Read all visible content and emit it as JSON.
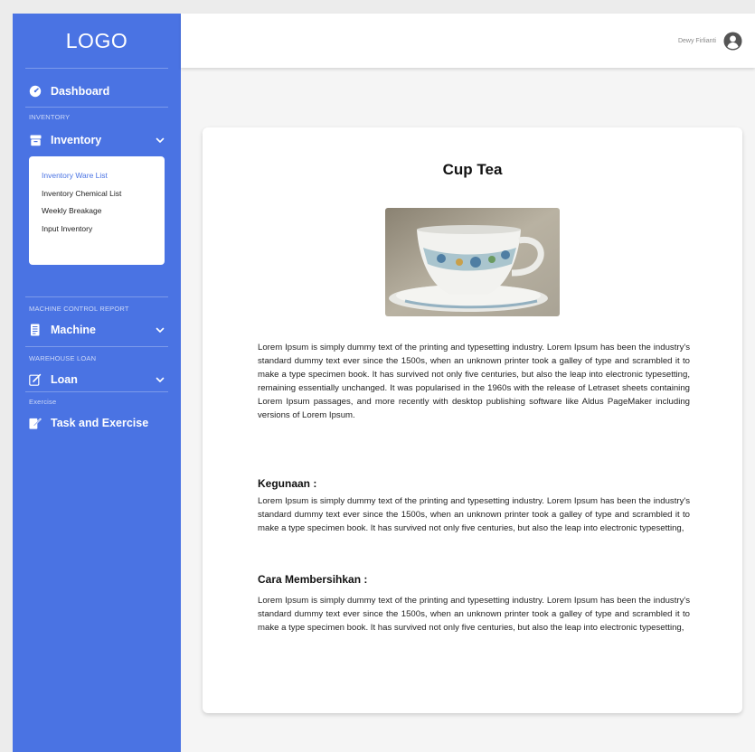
{
  "sidebar": {
    "logo": "LOGO",
    "dashboard": "Dashboard",
    "section_inventory": "INVENTORY",
    "inventory": "Inventory",
    "inventory_sub": [
      "Inventory Ware List",
      "Inventory Chemical List",
      "Weekly Breakage",
      "Input Inventory"
    ],
    "section_machine": "MACHINE CONTROL REPORT",
    "machine": "Machine",
    "section_warehouse": "WAREHOUSE LOAN",
    "loan": "Loan",
    "section_exercise": "Exercise",
    "task": "Task and Exercise"
  },
  "header": {
    "user_name": "Dewy Firlianti"
  },
  "content": {
    "title": "Cup Tea",
    "image_alt": "cup-tea-photo",
    "description": "Lorem Ipsum is simply dummy text of the printing and typesetting industry. Lorem Ipsum has been the industry's standard dummy text ever since the 1500s, when an unknown printer took a galley of type and scrambled it to make a type specimen book. It has survived not only five centuries, but also the leap into electronic typesetting, remaining essentially unchanged. It was popularised in the 1960s with the release of Letraset sheets containing Lorem Ipsum passages, and more recently with desktop publishing software like Aldus PageMaker including versions of Lorem Ipsum.",
    "kegunaan_heading": "Kegunaan :",
    "kegunaan_text": "Lorem Ipsum is simply dummy text of the printing and typesetting industry. Lorem Ipsum has been the industry's standard dummy text ever since the 1500s, when an unknown printer took a galley of type and scrambled it to make a type specimen book. It has survived not only five centuries, but also the leap into electronic typesetting,",
    "cara_heading": "Cara Membersihkan :",
    "cara_text": "Lorem Ipsum is simply dummy text of the printing and typesetting industry. Lorem Ipsum has been the industry's standard dummy text ever since the 1500s, when an unknown printer took a galley of type and scrambled it to make a type specimen book. It has survived not only five centuries, but also the leap into electronic typesetting,"
  },
  "colors": {
    "sidebar_bg": "#4a73e3",
    "active_link": "#4a73e3",
    "page_bg": "#f5f5f5"
  },
  "icons": {
    "dashboard": "speedometer-icon",
    "inventory": "archive-box-icon",
    "machine": "document-icon",
    "loan": "edit-icon",
    "task": "task-pen-icon",
    "user": "user-avatar-icon",
    "chevron": "chevron-down-icon"
  }
}
